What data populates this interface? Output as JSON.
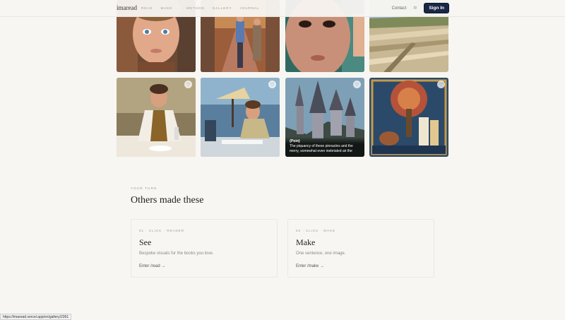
{
  "header": {
    "logo": "imaread",
    "nav": [
      "READ",
      "MAKE",
      "METHOD",
      "GALLERY",
      "JOURNAL"
    ],
    "contact": "Contact",
    "lang": "中",
    "signin": "Sign In"
  },
  "gallery": {
    "heart_icon": "heart-icon",
    "caption": {
      "title": "{Poin}",
      "text": "The piquancy of these pinnacles and the merry, somewhat even inebriated air the"
    }
  },
  "section": {
    "eyebrow": "YOUR TURN",
    "title": "Others made these",
    "panels": [
      {
        "step": "01 · CLICK · READER",
        "title": "See",
        "desc": "Bespoke visuals for the books you love.",
        "link": "Enter /read →"
      },
      {
        "step": "02 · CLICK · MAKE",
        "title": "Make",
        "desc": "One sentence, one image.",
        "link": "Enter /make →"
      }
    ]
  },
  "status_url": "https://imaread.vercel.app/en/gallery/2391",
  "colors": {
    "signin": "#1a2744",
    "background": "#f8f6f2"
  }
}
